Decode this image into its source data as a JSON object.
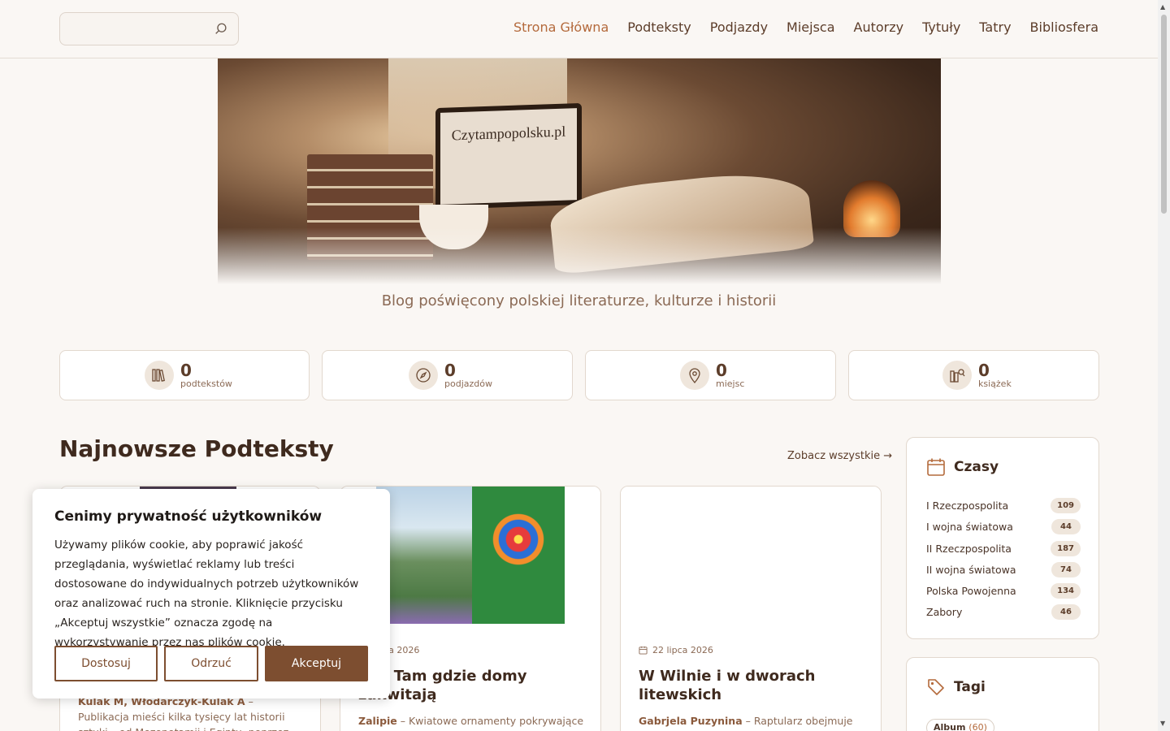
{
  "search": {
    "placeholder": ""
  },
  "nav": [
    {
      "label": "Strona Główna",
      "active": true
    },
    {
      "label": "Podteksty"
    },
    {
      "label": "Podjazdy"
    },
    {
      "label": "Miejsca"
    },
    {
      "label": "Autorzy"
    },
    {
      "label": "Tytuły"
    },
    {
      "label": "Tatry"
    },
    {
      "label": "Bibliosfera"
    }
  ],
  "hero": {
    "screen_text": "Czytampopolsku.pl"
  },
  "tagline": "Blog poświęcony polskiej literaturze, kulturze i historii",
  "stats": [
    {
      "value": "0",
      "label": "podtekstów",
      "icon": "books-icon"
    },
    {
      "value": "0",
      "label": "podjazdów",
      "icon": "compass-icon"
    },
    {
      "value": "0",
      "label": "miejsc",
      "icon": "map-pin-icon"
    },
    {
      "value": "0",
      "label": "książek",
      "icon": "book-search-icon"
    }
  ],
  "section": {
    "title": "Najnowsze Podteksty",
    "see_all": "Zobacz wszystkie →"
  },
  "cards": [
    {
      "date": "",
      "title": "",
      "excerpt_author": "Kulak M, Włodarczyk-Kulak A",
      "excerpt": " – Publikacja mieści kilka tysięcy lat historii sztuki – od Mezopotamii i Egiptu, poprzez Grecję, Rzym"
    },
    {
      "date": "sierpnia 2026",
      "title": "ipie Tam gdzie domy zakwitają",
      "excerpt_author": "Zalipie",
      "excerpt": " – Kwiatowe ornamenty pokrywające"
    },
    {
      "date": "22 lipca 2026",
      "title": "W Wilnie i w dworach litewskich",
      "excerpt_author": "Gabrjela Puzynina",
      "excerpt": " – Raptularz obejmuje lata"
    }
  ],
  "sidebar": {
    "czasy": {
      "title": "Czasy",
      "items": [
        {
          "label": "I Rzeczpospolita",
          "count": "109"
        },
        {
          "label": "I wojna światowa",
          "count": "44"
        },
        {
          "label": "II Rzeczpospolita",
          "count": "187"
        },
        {
          "label": "II wojna światowa",
          "count": "74"
        },
        {
          "label": "Polska Powojenna",
          "count": "134"
        },
        {
          "label": "Zabory",
          "count": "46"
        }
      ]
    },
    "tagi": {
      "title": "Tagi",
      "first_tag": {
        "label": "Album",
        "count": "(60)"
      }
    }
  },
  "cookie": {
    "title": "Cenimy prywatność użytkowników",
    "text": "Używamy plików cookie, aby poprawić jakość przeglądania, wyświetlać reklamy lub treści dostosowane do indywidualnych potrzeb użytkowników oraz analizować ruch na stronie. Kliknięcie przycisku „Akceptuj wszystkie” oznacza zgodę na wykorzystywanie przez nas plików cookie.",
    "customize": "Dostosuj",
    "reject": "Odrzuć",
    "accept": "Akceptuj"
  },
  "colors": {
    "accent": "#b46a3c",
    "brand_dark": "#7d4e30",
    "text": "#3f2a1e",
    "muted": "#8b6a55"
  }
}
